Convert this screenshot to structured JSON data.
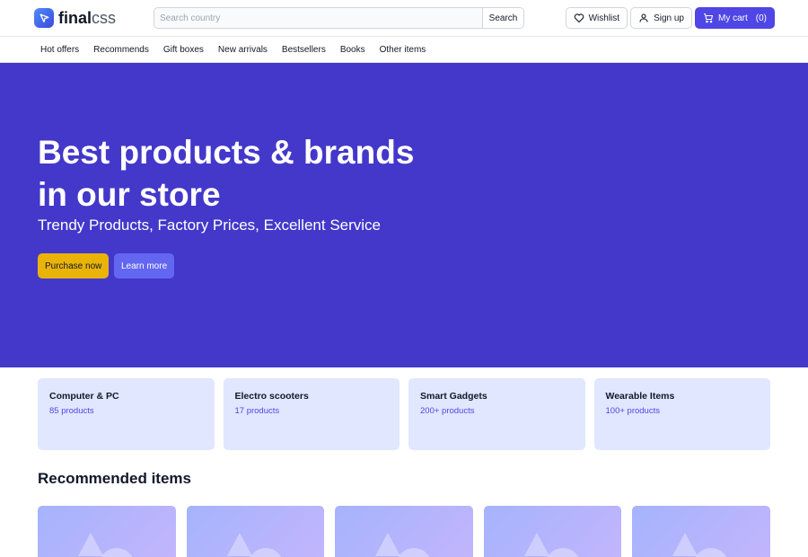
{
  "brand": {
    "logo_bold": "final",
    "logo_light": "css",
    "logo_icon": "pointer-logo-icon"
  },
  "search": {
    "placeholder": "Search country",
    "value": "",
    "button_label": "Search"
  },
  "header_actions": {
    "wishlist_label": "Wishlist",
    "signup_label": "Sign up",
    "cart_label": "My cart",
    "cart_count": "(0)"
  },
  "nav": {
    "items": [
      {
        "label": "Hot offers"
      },
      {
        "label": "Recommends"
      },
      {
        "label": "Gift boxes"
      },
      {
        "label": "New arrivals"
      },
      {
        "label": "Bestsellers"
      },
      {
        "label": "Books"
      },
      {
        "label": "Other items"
      }
    ]
  },
  "hero": {
    "title": "Best products & brands in our store",
    "subtitle": "Trendy Products, Factory Prices, Excellent Service",
    "primary_cta": "Purchase now",
    "secondary_cta": "Learn more"
  },
  "categories": [
    {
      "title": "Computer & PC",
      "count": "85 products"
    },
    {
      "title": "Electro scooters",
      "count": "17 products"
    },
    {
      "title": "Smart Gadgets",
      "count": "200+ products"
    },
    {
      "title": "Wearable Items",
      "count": "100+ products"
    }
  ],
  "recommended": {
    "title": "Recommended items",
    "product_count_visible": 5
  },
  "colors": {
    "accent": "#4f46e5",
    "hero_bg": "#4338ca",
    "purchase_button": "#eab308",
    "learn_more_button": "#6366f1",
    "category_card_bg": "#e0e7ff"
  }
}
